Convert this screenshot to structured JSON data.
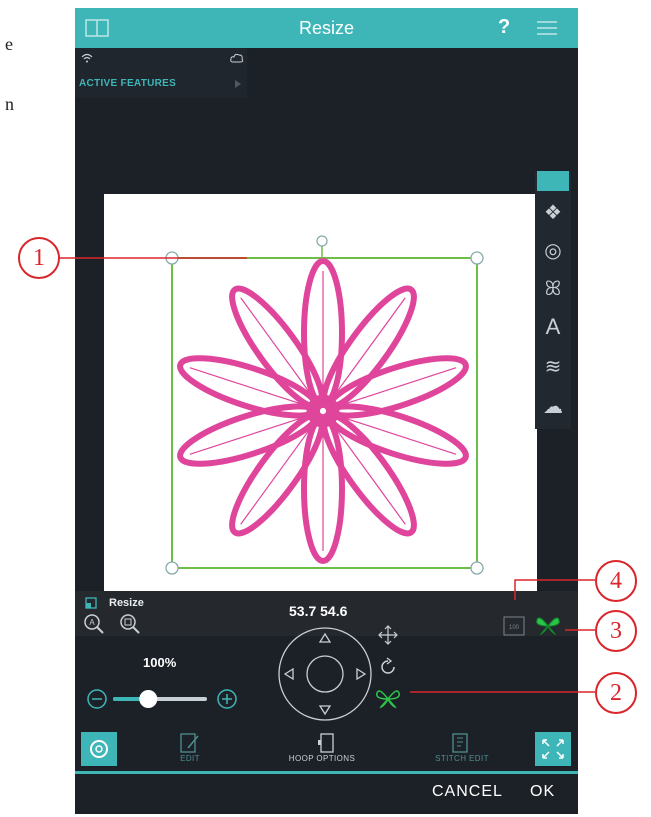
{
  "page_fragments": [
    "e",
    "n"
  ],
  "topbar": {
    "title": "Resize",
    "help": "?"
  },
  "active_features": {
    "label": "ACTIVE FEATURES"
  },
  "infobar": {
    "resize_label": "Resize",
    "coords": "53.7  54.6"
  },
  "controls": {
    "zoom_percent": "100%",
    "slider_level_fraction": 0.37
  },
  "bottom_tabs": {
    "edit": "EDIT",
    "hoop_options": "HOOP OPTIONS",
    "stitch_edit": "STITCH EDIT"
  },
  "actions": {
    "cancel": "CANCEL",
    "ok": "OK"
  },
  "callouts": [
    "1",
    "2",
    "3",
    "4"
  ],
  "colors": {
    "accent": "#3eb6b8",
    "design": "#e0459c",
    "frame": "#6dbe45",
    "callout": "#d9262c"
  }
}
